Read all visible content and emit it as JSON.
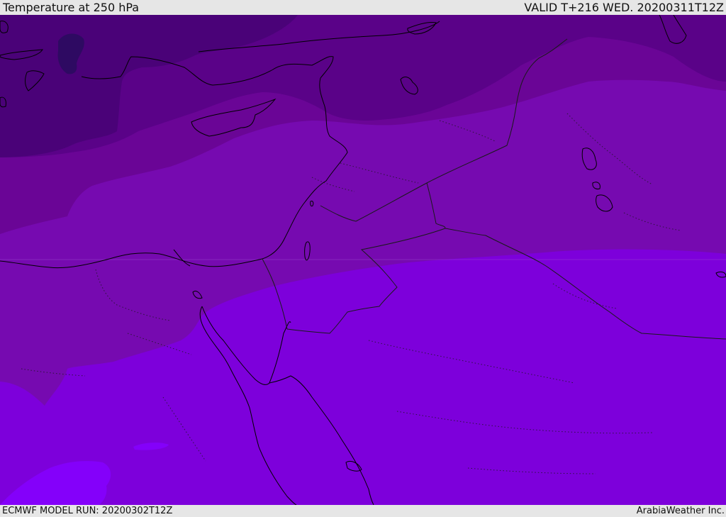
{
  "header": {
    "title": "Temperature at 250 hPa",
    "valid": "VALID T+216 WED. 20200311T12Z"
  },
  "footer": {
    "model_run": "ECMWF MODEL RUN: 20200302T12Z",
    "credit": "ArabiaWeather Inc."
  },
  "map": {
    "region": "Eastern Mediterranean and Middle East",
    "field": "Temperature at 250 hPa",
    "bands": [
      {
        "level": "coldest",
        "color": "#2e0a62"
      },
      {
        "level": "very-cold",
        "color": "#4a0278"
      },
      {
        "level": "cold",
        "color": "#5a0288"
      },
      {
        "level": "moderate-cold",
        "color": "#6a0596"
      },
      {
        "level": "moderate",
        "color": "#760ab0"
      },
      {
        "level": "mild",
        "color": "#7d00db"
      },
      {
        "level": "warmest",
        "color": "#8400fa"
      }
    ],
    "coastline_color": "#000000",
    "border_color": "#1a1a1a"
  }
}
